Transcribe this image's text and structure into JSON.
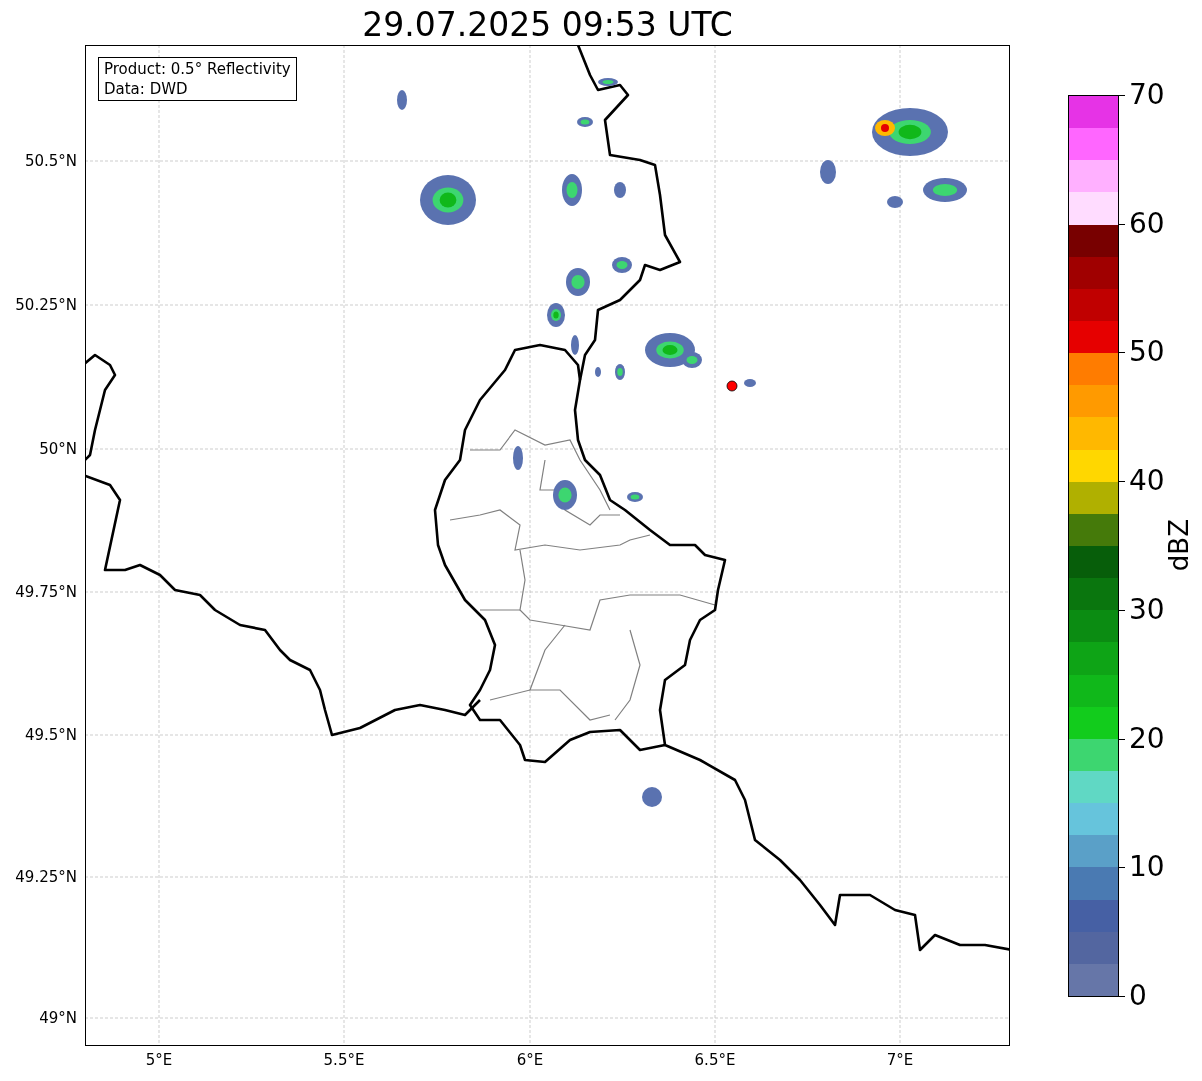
{
  "title": "29.07.2025 09:53 UTC",
  "info_box": [
    "Product: 0.5° Reflectivity",
    "Data: DWD"
  ],
  "y_ticks": [
    "50.5°N",
    "50.25°N",
    "50°N",
    "49.75°N",
    "49.5°N",
    "49.25°N",
    "49°N"
  ],
  "x_ticks": [
    "5°E",
    "5.5°E",
    "6°E",
    "6.5°E",
    "7°E"
  ],
  "colorbar": {
    "label": "dBZ",
    "ticks": [
      "70",
      "60",
      "50",
      "40",
      "30",
      "20",
      "10",
      "0"
    ],
    "bins": [
      {
        "color": "#6676a8"
      },
      {
        "color": "#5366a0"
      },
      {
        "color": "#4660a4"
      },
      {
        "color": "#4a7ab2"
      },
      {
        "color": "#5aa0c8"
      },
      {
        "color": "#66c4dc"
      },
      {
        "color": "#60d8c4"
      },
      {
        "color": "#3dd670"
      },
      {
        "color": "#12cc1c"
      },
      {
        "color": "#10b81a"
      },
      {
        "color": "#0ea416"
      },
      {
        "color": "#0b8c12"
      },
      {
        "color": "#0a760e"
      },
      {
        "color": "#075e0a"
      },
      {
        "color": "#457a0a"
      },
      {
        "color": "#b0b000"
      },
      {
        "color": "#ffd700"
      },
      {
        "color": "#ffb800"
      },
      {
        "color": "#ff9a00"
      },
      {
        "color": "#ff7c00"
      },
      {
        "color": "#e60000"
      },
      {
        "color": "#c00000"
      },
      {
        "color": "#a00000"
      },
      {
        "color": "#780000"
      },
      {
        "color": "#ffdcff"
      },
      {
        "color": "#ffb0ff"
      },
      {
        "color": "#ff66ff"
      },
      {
        "color": "#e633e6"
      }
    ]
  }
}
